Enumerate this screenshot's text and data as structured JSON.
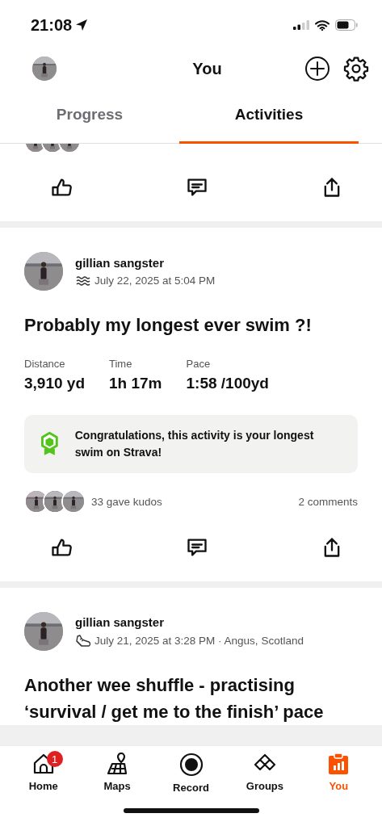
{
  "status_bar": {
    "time": "21:08"
  },
  "header": {
    "title": "You"
  },
  "tabs": [
    {
      "label": "Progress",
      "selected": false
    },
    {
      "label": "Activities",
      "selected": true
    }
  ],
  "activities": [
    {
      "athlete": "gillian sangster",
      "kind": "swim",
      "date": "July 22, 2025 at 5:04 PM",
      "title": "Probably my longest ever swim ?!",
      "stats": [
        {
          "label": "Distance",
          "value": "3,910 yd"
        },
        {
          "label": "Time",
          "value": "1h 17m"
        },
        {
          "label": "Pace",
          "value": "1:58 /100yd"
        }
      ],
      "achievement": "Congratulations, this activity is your longest swim on Strava!",
      "kudos": "33 gave kudos",
      "comments": "2 comments"
    },
    {
      "athlete": "gillian sangster",
      "kind": "run",
      "date": "July 21, 2025 at 3:28 PM · Angus, Scotland",
      "title": "Another wee shuffle - practising ‘survival / get me to the finish’ pace"
    }
  ],
  "nav": [
    {
      "label": "Home",
      "kind": "home",
      "badge": "1",
      "selected": false
    },
    {
      "label": "Maps",
      "kind": "maps",
      "selected": false
    },
    {
      "label": "Record",
      "kind": "record",
      "selected": false
    },
    {
      "label": "Groups",
      "kind": "groups",
      "selected": false
    },
    {
      "label": "You",
      "kind": "you",
      "selected": true
    }
  ]
}
